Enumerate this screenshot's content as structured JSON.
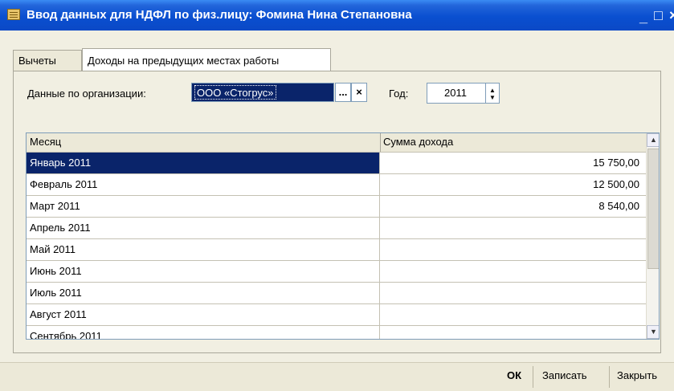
{
  "window": {
    "title": "Ввод данных для НДФЛ по физ.лицу: Фомина Нина Степановна",
    "controls": {
      "minimize": "_",
      "maximize": "□",
      "close": "×"
    }
  },
  "tabs": [
    {
      "label": "Вычеты",
      "active": false
    },
    {
      "label": "Доходы на предыдущих местах работы",
      "active": true
    }
  ],
  "form": {
    "org_label": "Данные по организации:",
    "org_value": "ООО «Стогрус»",
    "org_select_btn": "...",
    "org_clear_btn": "×",
    "year_label": "Год:",
    "year_value": "2011"
  },
  "table": {
    "headers": [
      "Месяц",
      "Сумма дохода"
    ],
    "rows": [
      {
        "month": "Январь 2011",
        "amount": "15 750,00",
        "selected": true
      },
      {
        "month": "Февраль 2011",
        "amount": "12 500,00"
      },
      {
        "month": "Март 2011",
        "amount": "8 540,00"
      },
      {
        "month": "Апрель 2011",
        "amount": ""
      },
      {
        "month": "Май 2011",
        "amount": ""
      },
      {
        "month": "Июнь 2011",
        "amount": ""
      },
      {
        "month": "Июль 2011",
        "amount": ""
      },
      {
        "month": "Август 2011",
        "amount": ""
      },
      {
        "month": "Сентябрь 2011",
        "amount": ""
      }
    ]
  },
  "footer": {
    "ok": "ОК",
    "save": "Записать",
    "close": "Закрыть"
  },
  "colors": {
    "title_bar": "#0b4fd0",
    "selection": "#0a246a",
    "window_bg": "#f1efe2"
  }
}
